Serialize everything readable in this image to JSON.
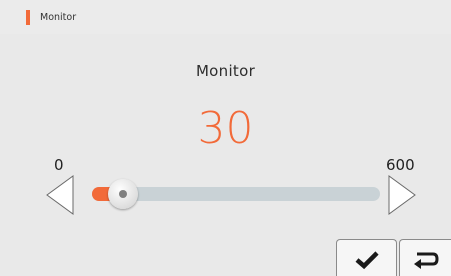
{
  "header": {
    "title": "Monitor",
    "accent_color": "#f26a39"
  },
  "parameter": {
    "label": "Monitor",
    "value": "30",
    "value_color": "#f26a39",
    "min": "0",
    "max": "600",
    "slider_value": 30
  },
  "footer": {
    "confirm_icon": "checkmark-icon",
    "back_icon": "return-arrow-icon"
  }
}
